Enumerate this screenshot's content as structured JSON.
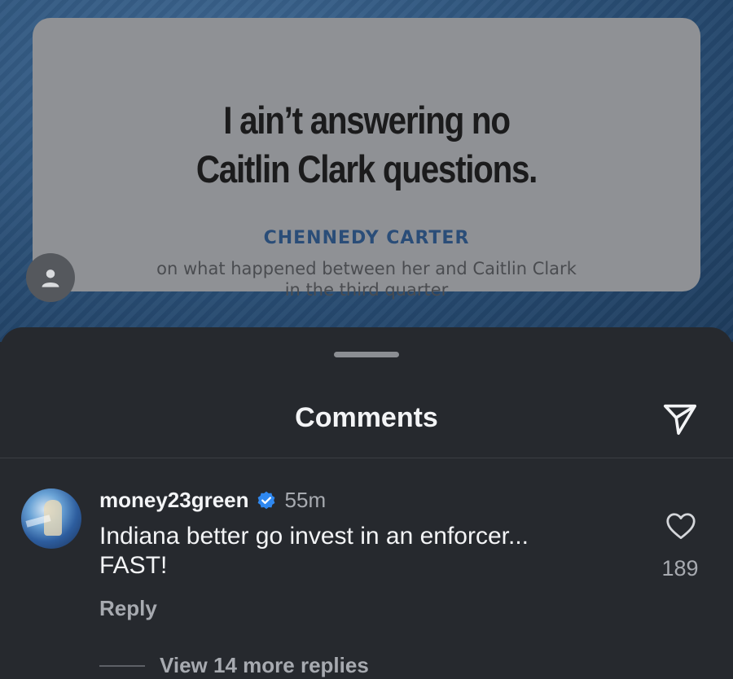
{
  "post": {
    "quote_line1": "I ain’t answering no",
    "quote_line2": "Caitlin Clark questions.",
    "speaker": "CHENNEDY CARTER",
    "context_line1": "on what happened between her and Caitlin Clark",
    "context_line2": "in the third quarter",
    "avatar_icon": "user-icon"
  },
  "sheet": {
    "title": "Comments",
    "share_icon": "send-icon"
  },
  "comments": [
    {
      "username": "money23green",
      "verified": true,
      "time": "55m",
      "text_line1": "Indiana better go invest in an enforcer...",
      "text_line2": "FAST!",
      "reply_label": "Reply",
      "like_count": "189",
      "view_replies_label": "View 14 more replies"
    }
  ],
  "colors": {
    "sheet_background": "#26292e",
    "verified_badge": "#2f88f0",
    "speaker_text": "#2a4d78"
  }
}
